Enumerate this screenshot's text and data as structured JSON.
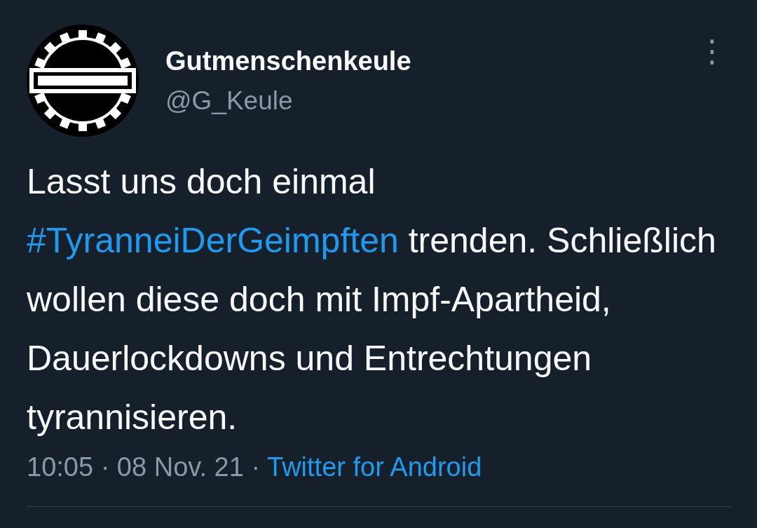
{
  "author": {
    "name": "Gutmenschenkeule",
    "handle": "@G_Keule"
  },
  "menu": {
    "icon": "⋮"
  },
  "body": [
    {
      "kind": "text",
      "text": "Lasst uns doch einmal "
    },
    {
      "kind": "hashtag",
      "text": "#TyranneiDerGeimpften"
    },
    {
      "kind": "text",
      "text": " trenden. Schließlich wollen diese doch mit Impf-Apartheid, Dauerlockdowns und Entrechtungen tyrannisieren."
    }
  ],
  "meta": "10:05 · 08 Nov. 21 ·",
  "source": "Twitter for Android"
}
